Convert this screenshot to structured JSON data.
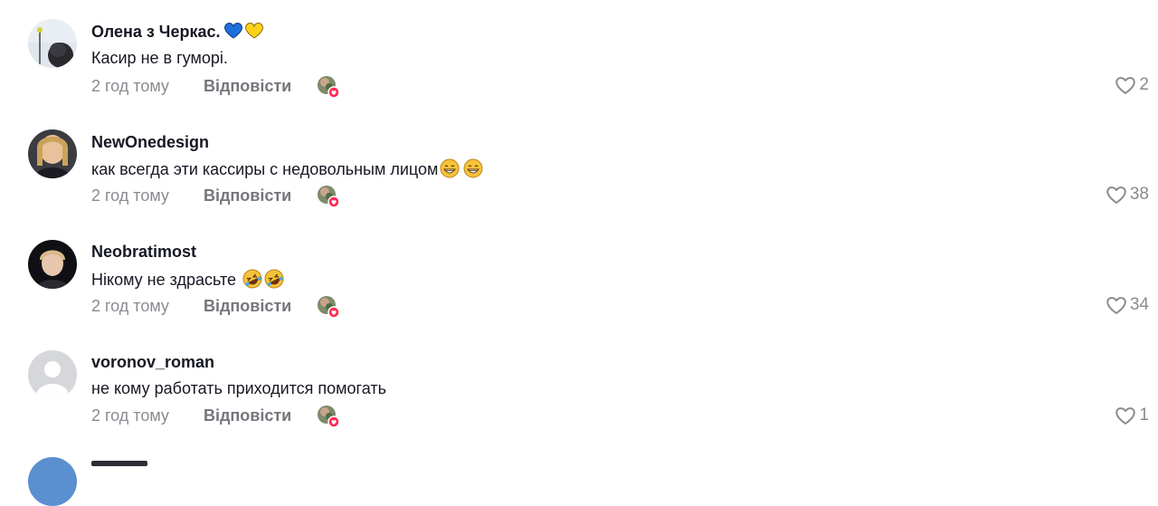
{
  "colors": {
    "text_primary": "#161823",
    "text_secondary": "#8a8b91",
    "reply": "#75767c",
    "like_icon": "#8a8b91",
    "reaction_badge": "#fe2c55"
  },
  "comments": [
    {
      "username": "Олена з Черкас.",
      "username_emoji": [
        "blue-heart-icon",
        "yellow-heart-icon"
      ],
      "text": "Касир не в гуморі.",
      "text_emoji": [],
      "time": "2 год тому",
      "reply_label": "Відповісти",
      "likes": "2",
      "avatar_icon": "photo-avatar-icon"
    },
    {
      "username": "NewOnedesign",
      "username_emoji": [],
      "text": "как всегда эти кассиры с недовольным лицом",
      "text_emoji": [
        "grinning-face-icon",
        "grinning-face-icon"
      ],
      "time": "2 год тому",
      "reply_label": "Відповісти",
      "likes": "38",
      "avatar_icon": "photo-avatar-icon"
    },
    {
      "username": "Neobratimost",
      "username_emoji": [],
      "text": "Нікому не здрасьте ",
      "text_emoji": [
        "rolling-laughing-face-icon",
        "rolling-laughing-face-icon"
      ],
      "time": "2 год тому",
      "reply_label": "Відповісти",
      "likes": "34",
      "avatar_icon": "photo-avatar-icon"
    },
    {
      "username": "voronov_roman",
      "username_emoji": [],
      "text": "не кому работать приходится помогать",
      "text_emoji": [],
      "time": "2 год тому",
      "reply_label": "Відповісти",
      "likes": "1",
      "avatar_icon": "default-avatar-icon"
    }
  ]
}
